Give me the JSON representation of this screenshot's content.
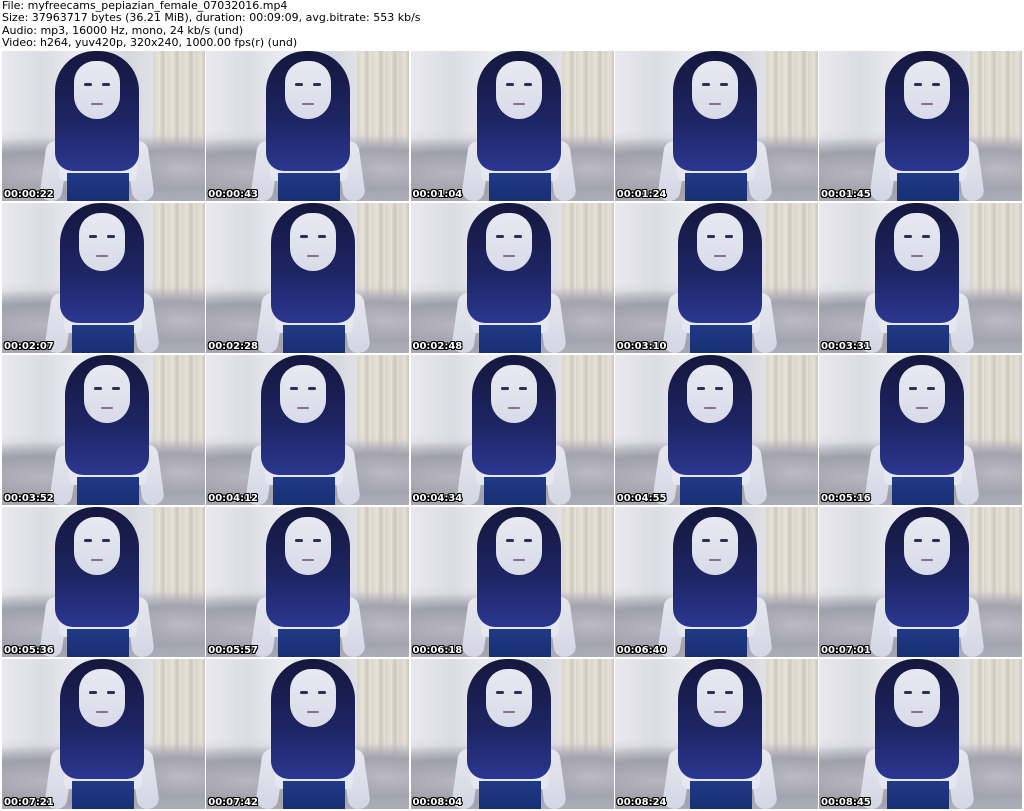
{
  "header": {
    "file_line": "File: myfreecams_pepiazian_female_07032016.mp4",
    "size_line": "Size: 37963717 bytes (36.21 MiB), duration: 00:09:09, avg.bitrate: 553 kb/s",
    "audio_line": "Audio: mp3, 16000 Hz, mono, 24 kb/s (und)",
    "video_line": "Video: h264, yuv420p, 320x240, 1000.00 fps(r) (und)"
  },
  "thumbnails": [
    {
      "timestamp": "00:00:22"
    },
    {
      "timestamp": "00:00:43"
    },
    {
      "timestamp": "00:01:04"
    },
    {
      "timestamp": "00:01:24"
    },
    {
      "timestamp": "00:01:45"
    },
    {
      "timestamp": "00:02:07"
    },
    {
      "timestamp": "00:02:28"
    },
    {
      "timestamp": "00:02:48"
    },
    {
      "timestamp": "00:03:10"
    },
    {
      "timestamp": "00:03:31"
    },
    {
      "timestamp": "00:03:52"
    },
    {
      "timestamp": "00:04:12"
    },
    {
      "timestamp": "00:04:34"
    },
    {
      "timestamp": "00:04:55"
    },
    {
      "timestamp": "00:05:16"
    },
    {
      "timestamp": "00:05:36"
    },
    {
      "timestamp": "00:05:57"
    },
    {
      "timestamp": "00:06:18"
    },
    {
      "timestamp": "00:06:40"
    },
    {
      "timestamp": "00:07:01"
    },
    {
      "timestamp": "00:07:21"
    },
    {
      "timestamp": "00:07:42"
    },
    {
      "timestamp": "00:08:04"
    },
    {
      "timestamp": "00:08:24"
    },
    {
      "timestamp": "00:08:45"
    }
  ]
}
